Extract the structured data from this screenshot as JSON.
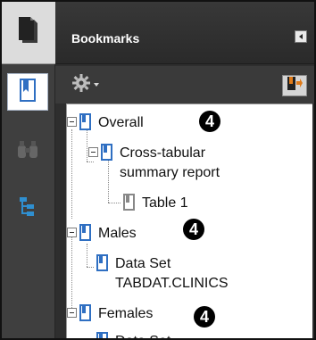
{
  "panel": {
    "title": "Bookmarks"
  },
  "rail": {
    "icons": [
      "pages-icon",
      "bookmarks-icon",
      "binoculars-icon",
      "tree-structure-icon"
    ]
  },
  "toolbar": {
    "options_icon": "gear-icon",
    "action_icon": "expand-bookmark-icon"
  },
  "tree": {
    "items": [
      {
        "label": "Overall",
        "badge": "4"
      },
      {
        "label": "Cross-tabular summary report"
      },
      {
        "label": "Table 1"
      },
      {
        "label": "Males",
        "badge": "4"
      },
      {
        "label": "Data Set TABDAT.CLINICS"
      },
      {
        "label": "Females",
        "badge": "4"
      },
      {
        "label": "Data Set"
      }
    ]
  },
  "colors": {
    "panel_bg": "#2e2e2e",
    "rail_bg": "#3f3f3f",
    "bookmark_blue": "#2f6fc2",
    "tree_bg": "#ffffff"
  }
}
